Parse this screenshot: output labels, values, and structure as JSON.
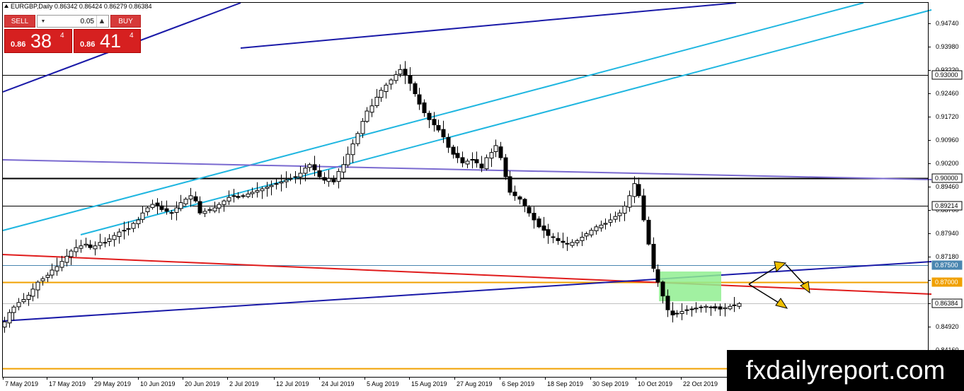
{
  "symbol_title": "EURGBP,Daily  0.86342 0.86424 0.86279 0.86384",
  "trade_panel": {
    "sell_label": "SELL",
    "buy_label": "BUY",
    "lot_value": "0.05",
    "sell_price_small": "0.86",
    "sell_price_big": "38",
    "sell_price_sup": "4",
    "buy_price_small": "0.86",
    "buy_price_big": "41",
    "buy_price_sup": "4"
  },
  "watermark": "fxdailyreport.com",
  "colors": {
    "bull_candle": "#ffffff",
    "bear_candle": "#000000",
    "channel": "#1fb6e0",
    "dark_trend": "#1a1aa8",
    "purple_trend": "#7a6ad0",
    "red_trend": "#e01c1c",
    "orange_level": "#f0a000",
    "steel_level": "#4a86b0",
    "green_box": "#90ee90",
    "arrow_fill": "#f0c000"
  },
  "chart_data": {
    "type": "candlestick",
    "title": "EURGBP,Daily",
    "ylim": [
      0.8426,
      0.9508
    ],
    "y_ticks": [
      "0.94740",
      "0.93980",
      "0.93220",
      "0.92460",
      "0.91720",
      "0.90960",
      "0.90200",
      "0.89460",
      "0.88700",
      "0.87940",
      "0.87180",
      "0.86420",
      "0.85680",
      "0.84920",
      "0.84160"
    ],
    "x_tick_labels": [
      "7 May 2019",
      "17 May 2019",
      "29 May 2019",
      "10 Jun 2019",
      "20 Jun 2019",
      "2 Jul 2019",
      "12 Jul 2019",
      "24 Jul 2019",
      "5 Aug 2019",
      "15 Aug 2019",
      "27 Aug 2019",
      "6 Sep 2019",
      "18 Sep 2019",
      "30 Sep 2019",
      "10 Oct 2019",
      "22 Oct 2019"
    ],
    "price_labels": [
      {
        "text": "0.93000",
        "value": 0.93,
        "style": "boxed"
      },
      {
        "text": "0.90000",
        "value": 0.9,
        "style": "boxed"
      },
      {
        "text": "0.89214",
        "value": 0.89214,
        "style": "boxed"
      },
      {
        "text": "0.87500",
        "value": 0.875,
        "style": "steel"
      },
      {
        "text": "0.87000",
        "value": 0.87,
        "style": "orange"
      },
      {
        "text": "0.86384",
        "value": 0.86384,
        "style": "boxed"
      }
    ],
    "horizontal_levels": [
      {
        "value": 0.93,
        "color": "#000000",
        "width": 1
      },
      {
        "value": 0.9,
        "color": "#000000",
        "width": 2
      },
      {
        "value": 0.89214,
        "color": "#000000",
        "width": 1
      },
      {
        "value": 0.875,
        "color": "#4a86b0",
        "width": 1
      },
      {
        "value": 0.87,
        "color": "#f0a000",
        "width": 2
      },
      {
        "value": 0.86384,
        "color": "#c0c0c0",
        "width": 1
      },
      {
        "value": 0.845,
        "color": "#f0a000",
        "width": 2
      }
    ],
    "closes": [
      0.8585,
      0.8612,
      0.8628,
      0.8641,
      0.865,
      0.8662,
      0.868,
      0.87,
      0.871,
      0.872,
      0.8735,
      0.8745,
      0.876,
      0.8775,
      0.879,
      0.88,
      0.8805,
      0.881,
      0.88,
      0.8805,
      0.8815,
      0.8815,
      0.8825,
      0.8835,
      0.8845,
      0.885,
      0.8855,
      0.887,
      0.888,
      0.89,
      0.8915,
      0.8925,
      0.892,
      0.891,
      0.8905,
      0.89,
      0.8915,
      0.893,
      0.894,
      0.895,
      0.8935,
      0.89,
      0.8905,
      0.891,
      0.8915,
      0.8925,
      0.8935,
      0.8945,
      0.895,
      0.8945,
      0.895,
      0.8955,
      0.896,
      0.8965,
      0.897,
      0.8975,
      0.898,
      0.8985,
      0.899,
      0.8995,
      0.9,
      0.9005,
      0.9015,
      0.903,
      0.904,
      0.9025,
      0.9005,
      0.8995,
      0.9,
      0.899,
      0.902,
      0.904,
      0.907,
      0.91,
      0.913,
      0.9165,
      0.9195,
      0.921,
      0.9235,
      0.9255,
      0.927,
      0.9285,
      0.93,
      0.9315,
      0.9298,
      0.9275,
      0.9245,
      0.9215,
      0.919,
      0.917,
      0.9155,
      0.914,
      0.912,
      0.909,
      0.907,
      0.906,
      0.9045,
      0.905,
      0.9055,
      0.9045,
      0.903,
      0.906,
      0.9075,
      0.9095,
      0.906,
      0.9005,
      0.896,
      0.895,
      0.894,
      0.892,
      0.89,
      0.888,
      0.886,
      0.885,
      0.8835,
      0.883,
      0.882,
      0.8815,
      0.881,
      0.8815,
      0.882,
      0.883,
      0.884,
      0.885,
      0.886,
      0.8865,
      0.887,
      0.888,
      0.889,
      0.89,
      0.892,
      0.895,
      0.8985,
      0.895,
      0.888,
      0.881,
      0.874,
      0.87,
      0.866,
      0.862,
      0.8605,
      0.861,
      0.8615,
      0.862,
      0.8622,
      0.8625,
      0.8628,
      0.863,
      0.8628,
      0.8625,
      0.8622,
      0.8626,
      0.863,
      0.8634,
      0.8638
    ],
    "annotations": [
      "rising cyan channel (Jun–Sep 2019)",
      "dark blue trendlines",
      "purple descending trendline",
      "red descending trendline",
      "green consolidation box",
      "yellow scenario arrows up and down"
    ]
  }
}
